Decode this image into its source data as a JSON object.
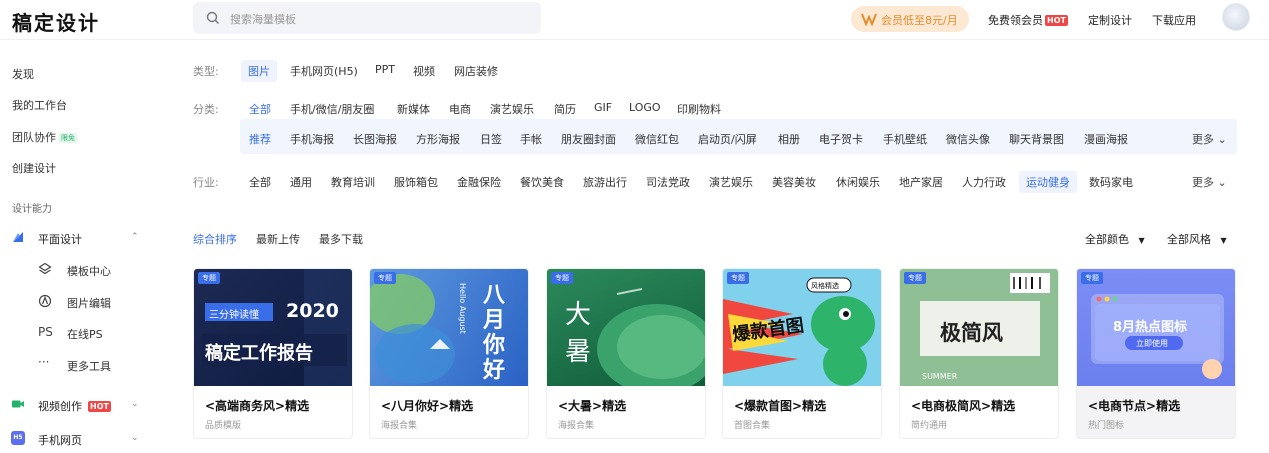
{
  "app": {
    "logo": "稿定设计"
  },
  "search": {
    "placeholder": "搜索海量模板"
  },
  "header": {
    "vip_label": "会员低至8元/月",
    "free_vip_label": "免费领会员",
    "hot_badge": "HOT",
    "custom_design": "定制设计",
    "download_app": "下载应用"
  },
  "sidebar": {
    "discover": "发现",
    "workspace": "我的工作台",
    "team": "团队协作",
    "team_badge": "限免",
    "create": "创建设计",
    "section_caption": "设计能力",
    "graphic_design": "平面设计",
    "graphic_sub": [
      {
        "icon": "layers-icon",
        "label": "模板中心"
      },
      {
        "icon": "image-edit-icon",
        "label": "图片编辑"
      },
      {
        "icon": "photoshop-icon",
        "label": "在线PS",
        "glyph": "PS"
      },
      {
        "icon": "more-dots-icon",
        "label": "更多工具",
        "glyph": "···"
      }
    ],
    "video_creation": "视频创作",
    "video_badge": "HOT",
    "mobile_web": "手机网页",
    "mobile_icon_text": "H5"
  },
  "filters": {
    "type_label": "类型:",
    "types": [
      "图片",
      "手机网页(H5)",
      "PPT",
      "视频",
      "网店装修"
    ],
    "category_label": "分类:",
    "categories": [
      "全部",
      "手机/微信/朋友圈",
      "新媒体",
      "电商",
      "演艺娱乐",
      "简历",
      "GIF",
      "LOGO",
      "印刷物料"
    ],
    "subcategories": [
      "推荐",
      "手机海报",
      "长图海报",
      "方形海报",
      "日签",
      "手帐",
      "朋友圈封面",
      "微信红包",
      "启动页/闪屏",
      "相册",
      "电子贺卡",
      "手机壁纸",
      "微信头像",
      "聊天背景图",
      "漫画海报"
    ],
    "more": "更多",
    "industry_label": "行业:",
    "industries": [
      "全部",
      "通用",
      "教育培训",
      "服饰箱包",
      "金融保险",
      "餐饮美食",
      "旅游出行",
      "司法党政",
      "演艺娱乐",
      "美容美妆",
      "休闲娱乐",
      "地产家居",
      "人力行政",
      "运动健身",
      "数码家电"
    ]
  },
  "sort": {
    "options": [
      "综合排序",
      "最新上传",
      "最多下载"
    ],
    "color_filter": "全部颜色",
    "style_filter": "全部风格"
  },
  "cards": [
    {
      "tag": "专题",
      "title": "<高端商务风>精选",
      "subtitle": "品质模版",
      "art_texts": [
        "三分钟读懂",
        "2020",
        "稿定工作报告"
      ]
    },
    {
      "tag": "专题",
      "title": "<八月你好>精选",
      "subtitle": "海报合集",
      "art_texts": [
        "Hello August",
        "八",
        "月",
        "你",
        "好"
      ]
    },
    {
      "tag": "专题",
      "title": "<大暑>精选",
      "subtitle": "海报合集",
      "art_texts": [
        "大",
        "暑"
      ]
    },
    {
      "tag": "专题",
      "title": "<爆款首图>精选",
      "subtitle": "首图合集",
      "art_texts": [
        "爆款首图",
        "风格精选"
      ]
    },
    {
      "tag": "专题",
      "title": "<电商极简风>精选",
      "subtitle": "简约通用",
      "art_texts": [
        "极简风",
        "SUMMER"
      ]
    },
    {
      "tag": "专题",
      "title": "<电商节点>精选",
      "subtitle": "热门图标",
      "art_texts": [
        "8月热点图标",
        "立即使用"
      ]
    }
  ],
  "colors": {
    "accent": "#3a6ee8",
    "hot": "#f04646",
    "vip_bg": "#fde9d3"
  }
}
